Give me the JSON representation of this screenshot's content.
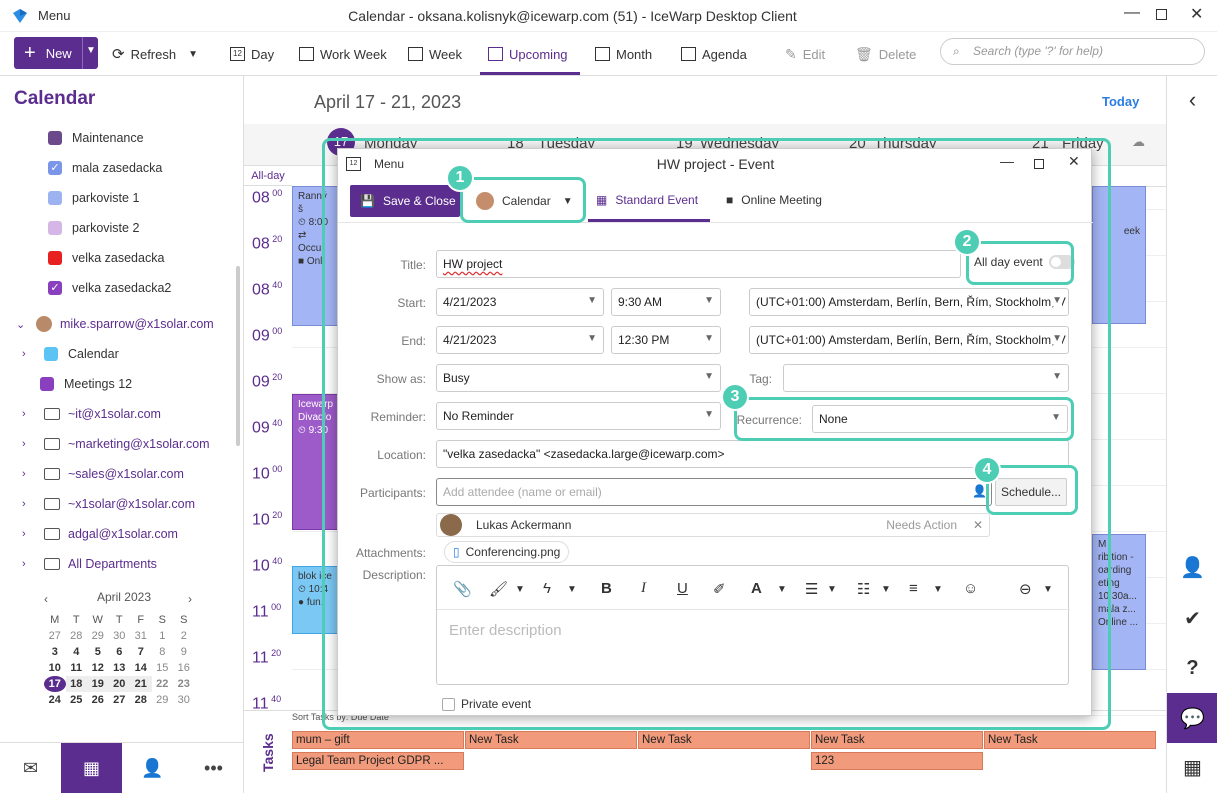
{
  "window": {
    "title": "Calendar - oksana.kolisnyk@icewarp.com (51) - IceWarp Desktop Client",
    "menu_label": "Menu"
  },
  "ribbon": {
    "new_label": "New",
    "refresh_label": "Refresh",
    "views": [
      "Day",
      "Work Week",
      "Week",
      "Upcoming",
      "Month",
      "Agenda"
    ],
    "active_view": "Upcoming",
    "edit_label": "Edit",
    "delete_label": "Delete",
    "search_placeholder": "Search (type '?' for help)"
  },
  "sidebar": {
    "title": "Calendar",
    "calendars": [
      {
        "label": "Maintenance",
        "color": "#6a4a8a",
        "checked": false
      },
      {
        "label": "mala zasedacka",
        "color": "#7b95e8",
        "checked": true
      },
      {
        "label": "parkoviste 1",
        "color": "#9db2f0",
        "checked": false
      },
      {
        "label": "parkoviste 2",
        "color": "#d4b7e6",
        "checked": false
      },
      {
        "label": "velka zasedacka",
        "color": "#e82020",
        "checked": false
      },
      {
        "label": "velka zasedacka2",
        "color": "#8a3fbf",
        "checked": true
      }
    ],
    "account": "mike.sparrow@x1solar.com",
    "account_items": [
      {
        "label": "Calendar",
        "color": "#5bc4f5"
      },
      {
        "label": "Meetings 12",
        "color": "#8a3fbf"
      }
    ],
    "folders": [
      "~it@x1solar.com",
      "~marketing@x1solar.com",
      "~sales@x1solar.com",
      "~x1solar@x1solar.com",
      "adgal@x1solar.com",
      "All Departments"
    ],
    "minical": {
      "month": "April 2023",
      "weekdays": [
        "M",
        "T",
        "W",
        "T",
        "F",
        "S",
        "S"
      ],
      "weeks": [
        [
          "27",
          "28",
          "29",
          "30",
          "31",
          "1",
          "2"
        ],
        [
          "3",
          "4",
          "5",
          "6",
          "7",
          "8",
          "9"
        ],
        [
          "10",
          "11",
          "12",
          "13",
          "14",
          "15",
          "16"
        ],
        [
          "17",
          "18",
          "19",
          "20",
          "21",
          "22",
          "23"
        ],
        [
          "24",
          "25",
          "26",
          "27",
          "28",
          "29",
          "30"
        ]
      ],
      "today": "17"
    }
  },
  "main": {
    "range_title": "April 17 - 21, 2023",
    "today_label": "Today",
    "allday_label": "All-day",
    "days": [
      {
        "num": "17",
        "name": "Monday"
      },
      {
        "num": "18",
        "name": "Tuesday"
      },
      {
        "num": "19",
        "name": "Wednesday"
      },
      {
        "num": "20",
        "name": "Thursday"
      },
      {
        "num": "21",
        "name": "Friday"
      }
    ],
    "hours": [
      {
        "h": "08",
        "m": "00"
      },
      {
        "h": "08",
        "m": "20"
      },
      {
        "h": "08",
        "m": "40"
      },
      {
        "h": "09",
        "m": "00"
      },
      {
        "h": "09",
        "m": "20"
      },
      {
        "h": "09",
        "m": "40"
      },
      {
        "h": "10",
        "m": "00"
      },
      {
        "h": "10",
        "m": "20"
      },
      {
        "h": "10",
        "m": "40"
      },
      {
        "h": "11",
        "m": "00"
      },
      {
        "h": "11",
        "m": "20"
      },
      {
        "h": "11",
        "m": "40"
      }
    ],
    "events": {
      "ev1": {
        "l1": "Ranný š",
        "l2": "⏲ 8:00",
        "l3": "⇄ Occu",
        "l4": "■ Onli"
      },
      "ev2": {
        "l1": "Icewarp",
        "l2": "Divadlo",
        "l3": "⏲ 9:30"
      },
      "ev3": {
        "l1": "blok ice",
        "l2": "⏲ 10:4",
        "l3": "● fun."
      },
      "ev4": {
        "l1": "eek"
      },
      "ev5": {
        "l1": "M",
        "l2": "ribition -",
        "l3": "oarding",
        "l4": "eting",
        "l5": "10:30a...",
        "l6": "mala z...",
        "l7": "Online ..."
      }
    },
    "tasks_label": "Tasks",
    "sort_label": "Sort Tasks by: Due Date",
    "tasks": [
      "mum – gift",
      "New Task",
      "New Task",
      "New Task",
      "New Task",
      "Legal Team Project GDPR ...",
      "123"
    ]
  },
  "dialog": {
    "menu_label": "Menu",
    "title": "HW project - Event",
    "save_close_label": "Save & Close",
    "calendar_label": "Calendar",
    "tab_standard": "Standard Event",
    "tab_online": "Online Meeting",
    "labels": {
      "title": "Title:",
      "start": "Start:",
      "end": "End:",
      "show_as": "Show as:",
      "tag": "Tag:",
      "reminder": "Reminder:",
      "recurrence": "Recurrence:",
      "location": "Location:",
      "participants": "Participants:",
      "attachments": "Attachments:",
      "description": "Description:"
    },
    "title_value": "HW project",
    "all_day_label": "All day event",
    "all_day_on": false,
    "start_date": "4/21/2023",
    "start_time": "9:30 AM",
    "end_date": "4/21/2023",
    "end_time": "12:30 PM",
    "timezone": "(UTC+01:00) Amsterdam, Berlín, Bern, Řím, Stockholm, V",
    "show_as_value": "Busy",
    "tag_value": "",
    "reminder_value": "No Reminder",
    "recurrence_value": "None",
    "location_value": "\"velka zasedacka\" <zasedacka.large@icewarp.com>",
    "participants_placeholder": "Add attendee (name or email)",
    "schedule_label": "Schedule...",
    "attendee_name": "Lukas Ackermann",
    "attendee_status": "Needs Action",
    "attachment_name": "Conferencing.png",
    "description_placeholder": "Enter description",
    "private_label": "Private event"
  },
  "callouts": [
    "1",
    "2",
    "3",
    "4"
  ],
  "accent_color": "#5b2d8e",
  "highlight_color": "#4ecdb5"
}
